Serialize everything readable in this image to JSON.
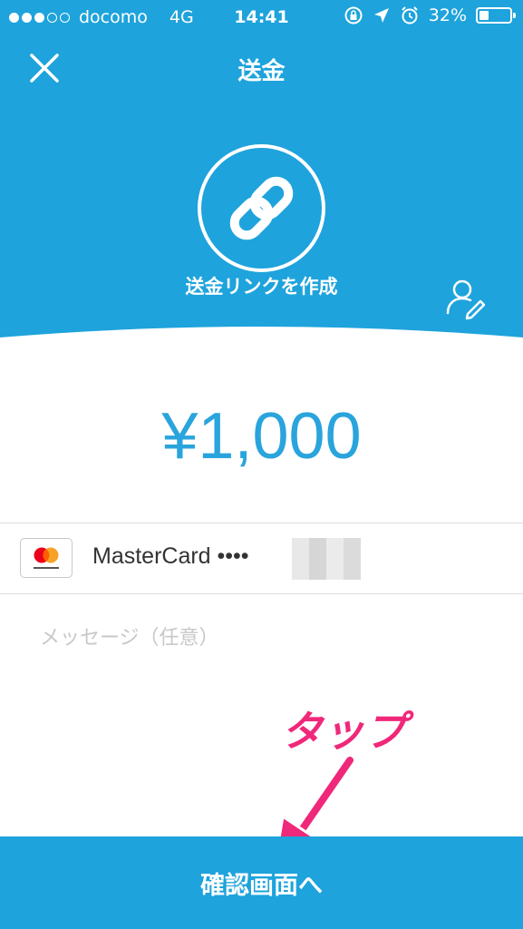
{
  "status_bar": {
    "carrier": "docomo",
    "network": "4G",
    "time": "14:41",
    "battery_percent": "32%",
    "battery_level": 0.32
  },
  "nav": {
    "title": "送金"
  },
  "header": {
    "create_link_label": "送金リンクを作成"
  },
  "amount": "¥1,000",
  "payment_card": {
    "brand": "MasterCard",
    "masked_label": "MasterCard ••••"
  },
  "message": {
    "placeholder": "メッセージ（任意）",
    "value": ""
  },
  "annotation": {
    "tap_label": "タップ"
  },
  "confirm_button": {
    "label": "確認画面へ"
  },
  "colors": {
    "primary_blue": "#1ea3dc",
    "amount_blue": "#2aa4dc",
    "annotation_pink": "#f0287a"
  }
}
